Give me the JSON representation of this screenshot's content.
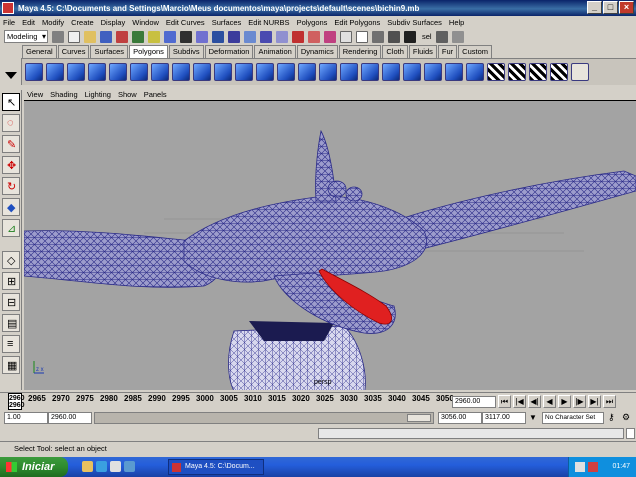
{
  "window": {
    "title": "Maya 4.5: C:\\Documents and Settings\\Marcio\\Meus documentos\\maya\\projects\\default\\scenes\\bichin9.mb",
    "buttons": [
      "_",
      "□",
      "×"
    ]
  },
  "menubar": [
    "File",
    "Edit",
    "Modify",
    "Create",
    "Display",
    "Window",
    "Edit Curves",
    "Surfaces",
    "Edit NURBS",
    "Polygons",
    "Edit Polygons",
    "Subdiv Surfaces",
    "Help"
  ],
  "modebar": {
    "mode_value": "Modeling",
    "sel_label": "sel"
  },
  "shelf": {
    "tabs": [
      "General",
      "Curves",
      "Surfaces",
      "Polygons",
      "Subdivs",
      "Deformation",
      "Animation",
      "Dynamics",
      "Rendering",
      "Cloth",
      "Fluids",
      "Fur",
      "Custom"
    ],
    "active_tab": "Polygons"
  },
  "panel_menu": [
    "View",
    "Shading",
    "Lighting",
    "Show",
    "Panels"
  ],
  "viewport": {
    "camera_label": "persp"
  },
  "time_slider": {
    "current_frame_top": "2960",
    "current_frame_bottom": "2960",
    "ticks": [
      "2960",
      "2965",
      "2970",
      "2975",
      "2980",
      "2985",
      "2990",
      "2995",
      "3000",
      "3005",
      "3010",
      "3015",
      "3020",
      "3025",
      "3030",
      "3035",
      "3040",
      "3045",
      "3050",
      "305"
    ],
    "current_time": "2960.00"
  },
  "range_slider": {
    "start_time": "1.00",
    "playback_start": "2960.00",
    "playback_end": "3056.00",
    "end_time": "3117.00",
    "character_set": "No Character Set"
  },
  "help_line": "Select Tool: select an object",
  "taskbar": {
    "start_label": "Iniciar",
    "task_label": "Maya 4.5: C:\\Docum...",
    "clock": "01:47"
  },
  "colors": {
    "title_bar": "#0a246a",
    "viewport_bg": "#a3a3a3",
    "wireframe": "#2b2b88",
    "mesh_fill": "#9c9ccc",
    "mouth": "#e02020",
    "taskbar": "#245edb",
    "start_button": "#2e8b2e"
  }
}
